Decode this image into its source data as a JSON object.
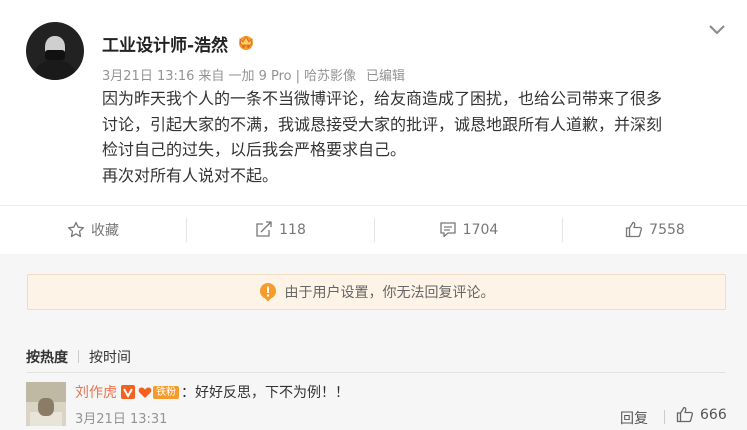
{
  "post": {
    "username": "工业设计师-浩然",
    "meta": {
      "date": "3月21日 13:16",
      "source_prefix": "来自",
      "device": "一加 9 Pro",
      "separator": "|",
      "camera": "哈苏影像",
      "edited": "已编辑"
    },
    "content_lines": [
      "因为昨天我个人的一条不当微博评论，给友商造成了困扰，也给公司带来了很多",
      "讨论，引起大家的不满，我诚恳接受大家的批评，诚恳地跟所有人道歉，并深刻",
      "检讨自己的过失，以后我会严格要求自己。",
      "再次对所有人说对不起。"
    ]
  },
  "actions": {
    "favorite_label": "收藏",
    "repost_count": "118",
    "comment_count": "1704",
    "like_count": "7558"
  },
  "notice": {
    "text": "由于用户设置，你无法回复评论。"
  },
  "sort": {
    "hot_label": "按热度",
    "time_label": "按时间"
  },
  "comment": {
    "author": "刘作虎",
    "fan_tag": "铁粉",
    "text": "：好好反思，下不为例！！",
    "time": "3月21日 13:31",
    "reply_label": "回复",
    "like_count": "666"
  },
  "colors": {
    "accent_name": "#eb7350",
    "notice_bg": "#fdf3e7",
    "notice_icon": "#f79b2b",
    "panel_bg": "#f6f6f6",
    "fan_tag": "#f49b2b"
  },
  "icons": [
    "chevron-down-icon",
    "vip-crown-icon",
    "star-icon",
    "share-icon",
    "comment-icon",
    "thumbs-up-icon",
    "warning-icon",
    "verified-v-icon",
    "fan-heart-icon"
  ]
}
